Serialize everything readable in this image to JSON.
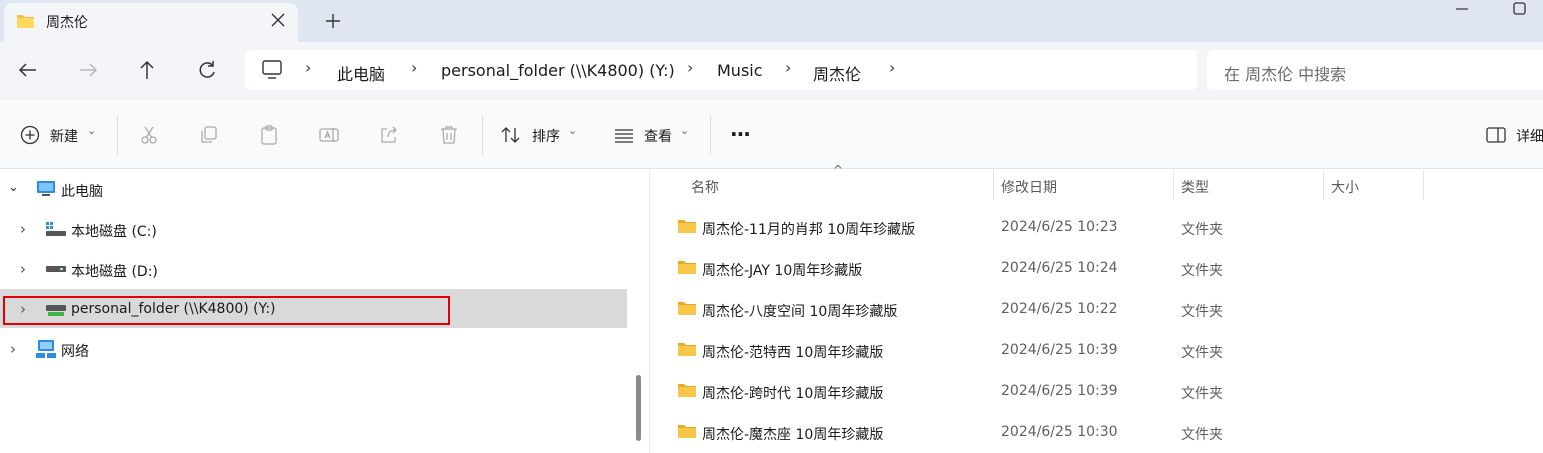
{
  "window": {
    "tab_title": "周杰伦"
  },
  "address_bar": {
    "crumbs": [
      "此电脑",
      "personal_folder (\\\\K4800) (Y:)",
      "Music",
      "周杰伦"
    ]
  },
  "search": {
    "placeholder": "在 周杰伦 中搜索"
  },
  "toolbar": {
    "new_label": "新建",
    "sort_label": "排序",
    "view_label": "查看",
    "more_label": "···",
    "details_label": "详细"
  },
  "nav_tree": {
    "items": [
      {
        "label": "此电脑",
        "icon": "computer-icon",
        "expanded": true
      },
      {
        "label": "本地磁盘 (C:)",
        "icon": "windows-drive-icon"
      },
      {
        "label": "本地磁盘 (D:)",
        "icon": "drive-icon"
      },
      {
        "label": "personal_folder (\\\\K4800) (Y:)",
        "icon": "network-drive-icon",
        "selected": true
      },
      {
        "label": "网络",
        "icon": "network-icon"
      }
    ]
  },
  "file_list": {
    "columns": [
      "名称",
      "修改日期",
      "类型",
      "大小"
    ],
    "rows": [
      {
        "name": "周杰伦-11月的肖邦 10周年珍藏版",
        "date": "2024/6/25 10:23",
        "type": "文件夹"
      },
      {
        "name": "周杰伦-JAY 10周年珍藏版",
        "date": "2024/6/25 10:24",
        "type": "文件夹"
      },
      {
        "name": "周杰伦-八度空间 10周年珍藏版",
        "date": "2024/6/25 10:22",
        "type": "文件夹"
      },
      {
        "name": "周杰伦-范特西 10周年珍藏版",
        "date": "2024/6/25 10:39",
        "type": "文件夹"
      },
      {
        "name": "周杰伦-跨时代 10周年珍藏版",
        "date": "2024/6/25 10:39",
        "type": "文件夹"
      },
      {
        "name": "周杰伦-魔杰座 10周年珍藏版",
        "date": "2024/6/25 10:30",
        "type": "文件夹"
      }
    ]
  },
  "colors": {
    "highlight_box": "#e00000",
    "folder": "#f5c242",
    "selection": "#d9d9d9"
  }
}
